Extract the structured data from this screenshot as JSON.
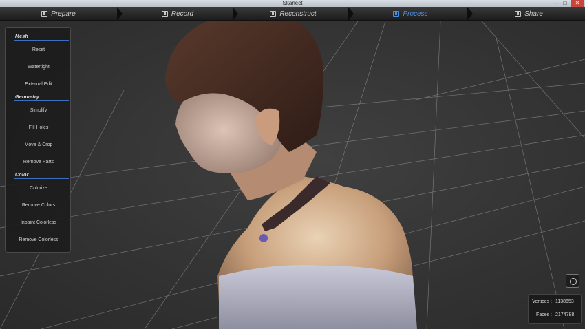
{
  "window": {
    "title": "Skanect",
    "controls": [
      "–",
      "□",
      "✕"
    ]
  },
  "steps": [
    {
      "label": "Prepare",
      "icon": "prepare-icon",
      "active": false
    },
    {
      "label": "Record",
      "icon": "record-icon",
      "active": false
    },
    {
      "label": "Reconstruct",
      "icon": "reconstruct-icon",
      "active": false
    },
    {
      "label": "Process",
      "icon": "process-icon",
      "active": true
    },
    {
      "label": "Share",
      "icon": "share-icon",
      "active": false
    }
  ],
  "panel": {
    "mesh": {
      "title": "Mesh",
      "buttons": [
        "Reset",
        "Watertight",
        "External Edit"
      ]
    },
    "geometry": {
      "title": "Geometry",
      "buttons": [
        "Simplify",
        "Fill Holes",
        "Move & Crop",
        "Remove Parts"
      ]
    },
    "color": {
      "title": "Color",
      "buttons": [
        "Colorize",
        "Remove Colors",
        "Inpaint Colorless",
        "Remove Colorless"
      ]
    }
  },
  "stats": {
    "vertices_label": "Vertices :",
    "vertices_value": "1138653",
    "faces_label": "Faces :",
    "faces_value": "2174788"
  },
  "colors": {
    "accent": "#4a8fe0",
    "section_line": "#3d6fbf",
    "background": "#303030"
  }
}
